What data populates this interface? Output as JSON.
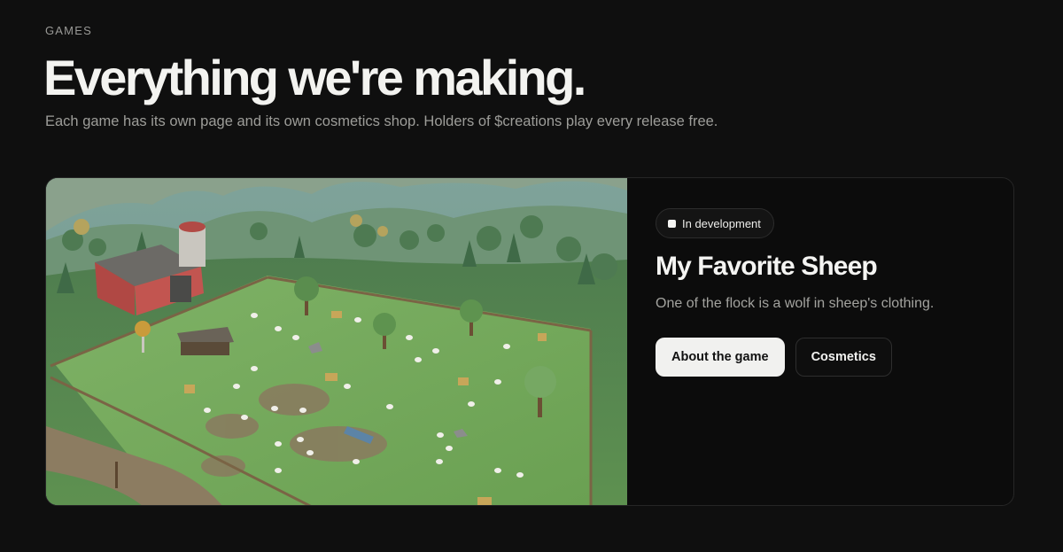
{
  "header": {
    "eyebrow": "GAMES",
    "title": "Everything we're making.",
    "subtitle": "Each game has its own page and its own cosmetics shop. Holders of $creations play every release free."
  },
  "games": [
    {
      "status": "In development",
      "title": "My Favorite Sheep",
      "description": "One of the flock is a wolf in sheep's clothing.",
      "primary_action": "About the game",
      "secondary_action": "Cosmetics",
      "screenshot_alt": "Low-poly farm with a red barn, fenced pasture, trees and a flock of sheep"
    }
  ]
}
